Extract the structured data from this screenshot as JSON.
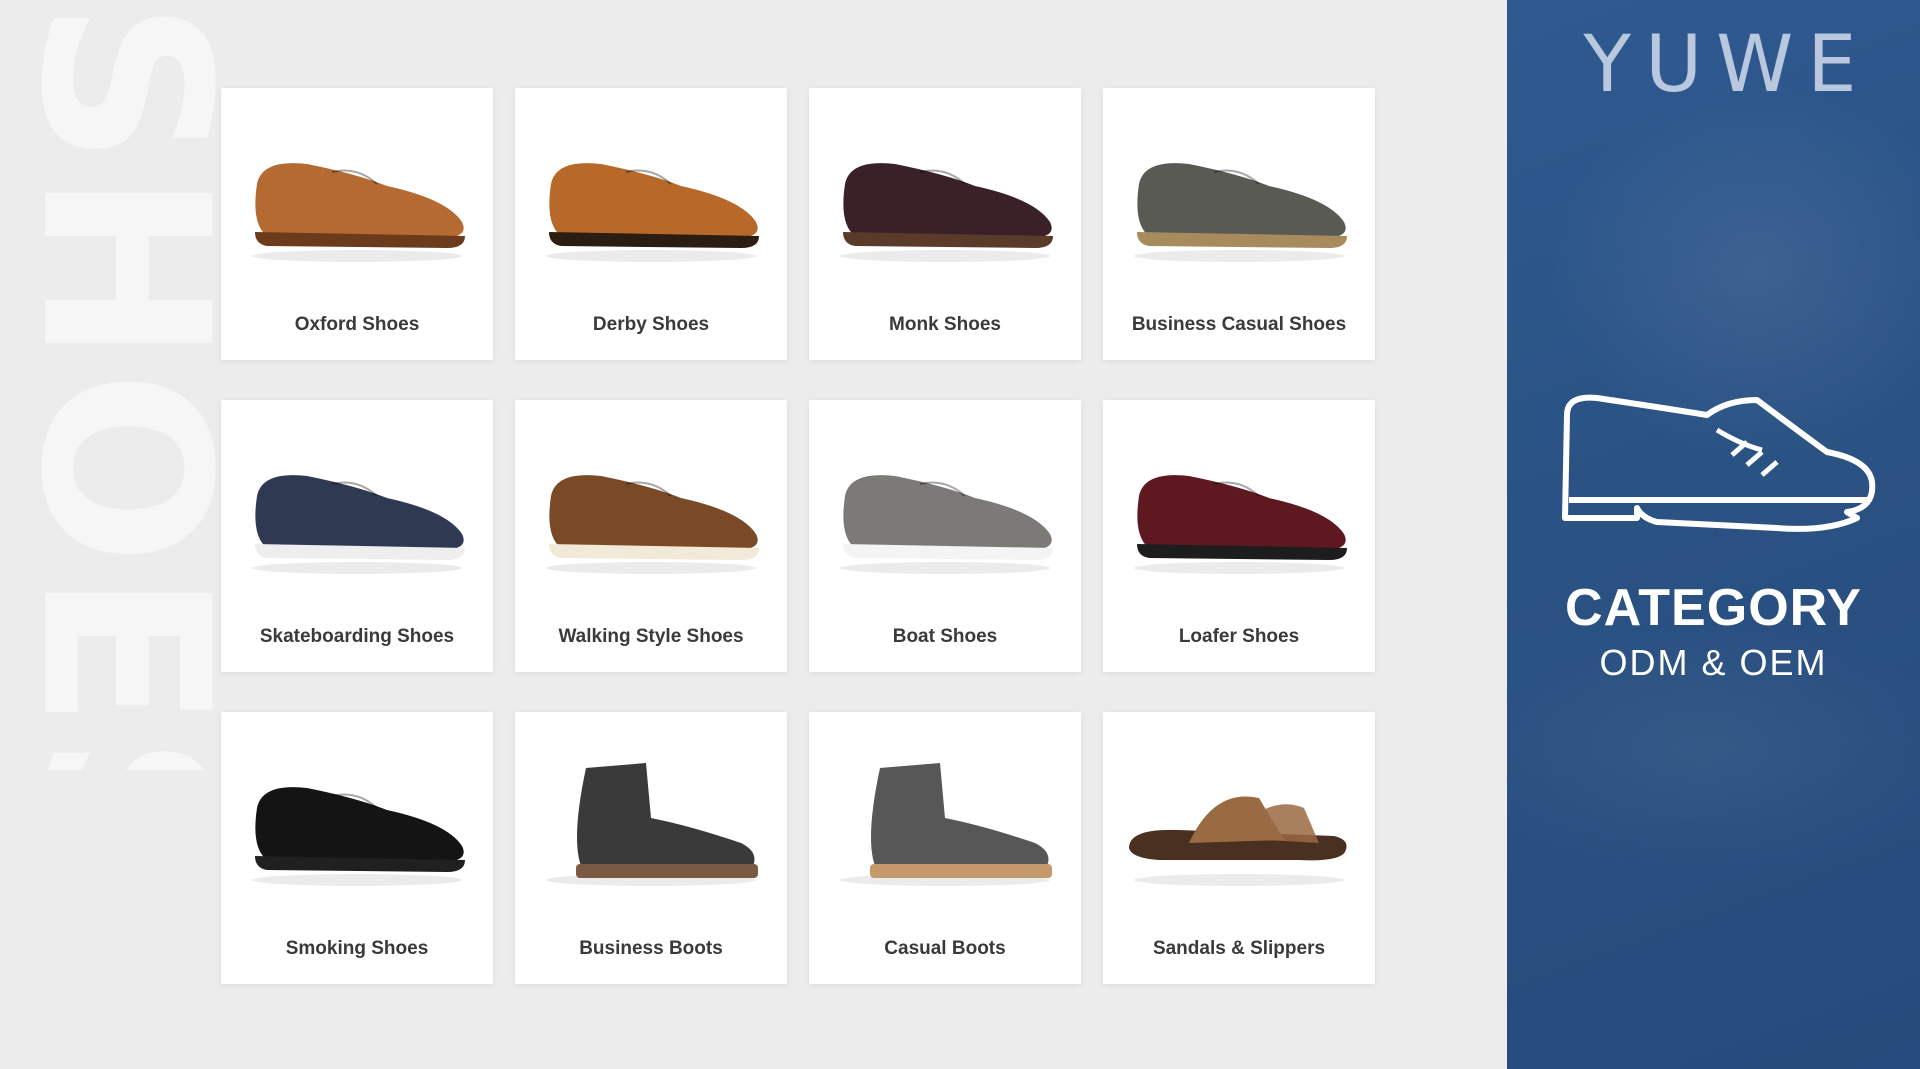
{
  "watermark": {
    "text": "SHOES"
  },
  "categories": [
    {
      "label": "Oxford Shoes",
      "icon": "oxford-shoe-icon",
      "upper": "#b56a32",
      "sole": "#6b3b1c"
    },
    {
      "label": "Derby Shoes",
      "icon": "derby-shoe-icon",
      "upper": "#b8692a",
      "sole": "#2b1d12"
    },
    {
      "label": "Monk Shoes",
      "icon": "monk-shoe-icon",
      "upper": "#3a2127",
      "sole": "#5a3a28"
    },
    {
      "label": "Business Casual Shoes",
      "icon": "business-casual-shoe-icon",
      "upper": "#5a5a55",
      "sole": "#a88b5c"
    },
    {
      "label": "Skateboarding Shoes",
      "icon": "skateboarding-shoe-icon",
      "upper": "#2f3a52",
      "sole": "#eeeeee"
    },
    {
      "label": "Walking Style Shoes",
      "icon": "walking-style-shoe-icon",
      "upper": "#7a4a26",
      "sole": "#f1ead8"
    },
    {
      "label": "Boat Shoes",
      "icon": "boat-shoe-icon",
      "upper": "#7c7a77",
      "sole": "#f4f4f4"
    },
    {
      "label": "Loafer Shoes",
      "icon": "loafer-shoe-icon",
      "upper": "#5e1820",
      "sole": "#1d1d1d"
    },
    {
      "label": "Smoking Shoes",
      "icon": "smoking-shoe-icon",
      "upper": "#141414",
      "sole": "#202020"
    },
    {
      "label": "Business Boots",
      "icon": "business-boot-icon",
      "upper": "#3a3a3a",
      "sole": "#7a5a42"
    },
    {
      "label": "Casual Boots",
      "icon": "casual-boot-icon",
      "upper": "#575757",
      "sole": "#c49a6c"
    },
    {
      "label": "Sandals & Slippers",
      "icon": "sandal-icon",
      "upper": "#9a6a42",
      "sole": "#4a3020"
    }
  ],
  "panel": {
    "brand": "YUWE",
    "icon": "shoe-outline-icon",
    "title": "CATEGORY",
    "subtitle": "ODM & OEM",
    "background": "#2b5486"
  }
}
